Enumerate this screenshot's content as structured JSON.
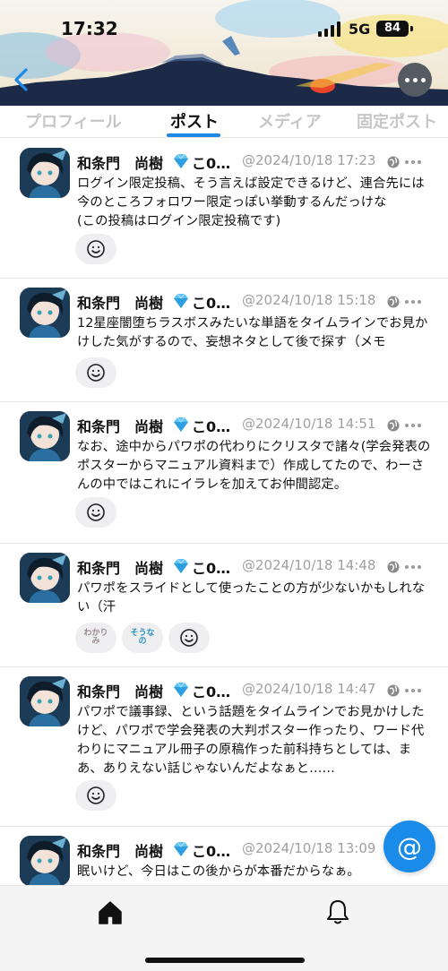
{
  "status_bar": {
    "time": "17:32",
    "network": "5G",
    "battery": "84"
  },
  "header": {
    "back_icon": "chevron-left-icon",
    "more_icon": "ellipsis-icon"
  },
  "tabs": [
    {
      "label": "プロフィール",
      "active": false
    },
    {
      "label": "ポスト",
      "active": true
    },
    {
      "label": "メディア",
      "active": false
    },
    {
      "label": "固定ポスト",
      "active": false
    }
  ],
  "author": {
    "name": "和条門　尚樹",
    "name_tail": "こ0…",
    "badge_icon": "gem-icon"
  },
  "posts": [
    {
      "timestamp": "@2024/10/18 17:23",
      "text": "ログイン限定投稿、そう言えば設定できるけど、連合先には今のところフォロワー限定っぽい挙動するんだっけな\n(この投稿はログイン限定投稿です)",
      "reactions": [
        "smile-add-icon"
      ]
    },
    {
      "timestamp": "@2024/10/18 15:18",
      "text": "12星座闇堕ちラスボスみたいな単語をタイムラインでお見かけした気がするので、妄想ネタとして後で探す（メモ",
      "reactions": [
        "smile-add-icon"
      ]
    },
    {
      "timestamp": "@2024/10/18 14:51",
      "text": "なお、途中からパワポの代わりにクリスタで諸々(学会発表のポスターからマニュアル資料まで）作成してたので、わーさんの中ではこれにイラレを加えてお仲間認定。",
      "reactions": [
        "smile-add-icon"
      ]
    },
    {
      "timestamp": "@2024/10/18 14:48",
      "text": "パワポをスライドとして使ったことの方が少ないかもしれない（汗",
      "reactions": [
        "わかりみ",
        "そうなの",
        "smile-add-icon"
      ]
    },
    {
      "timestamp": "@2024/10/18 14:47",
      "text": "パワポで議事録、という話題をタイムラインでお見かけしたけど、パワポで学会発表の大判ポスター作ったり、ワード代わりにマニュアル冊子の原稿作った前科持ちとしては、まあ、ありえない話じゃないんだよなぁと……",
      "reactions": [
        "smile-add-icon"
      ]
    },
    {
      "timestamp": "@2024/10/18 13:09",
      "text": "眠いけど、今日はこの後からが本番だからなぁ。",
      "reactions": []
    }
  ],
  "fab": {
    "label": "@"
  },
  "bottom_nav": {
    "home_icon": "home-icon",
    "notifications_icon": "bell-icon"
  },
  "colors": {
    "accent": "#1a8be8",
    "tab_inactive": "#c6c6c6",
    "timestamp": "#a0a0a0"
  }
}
